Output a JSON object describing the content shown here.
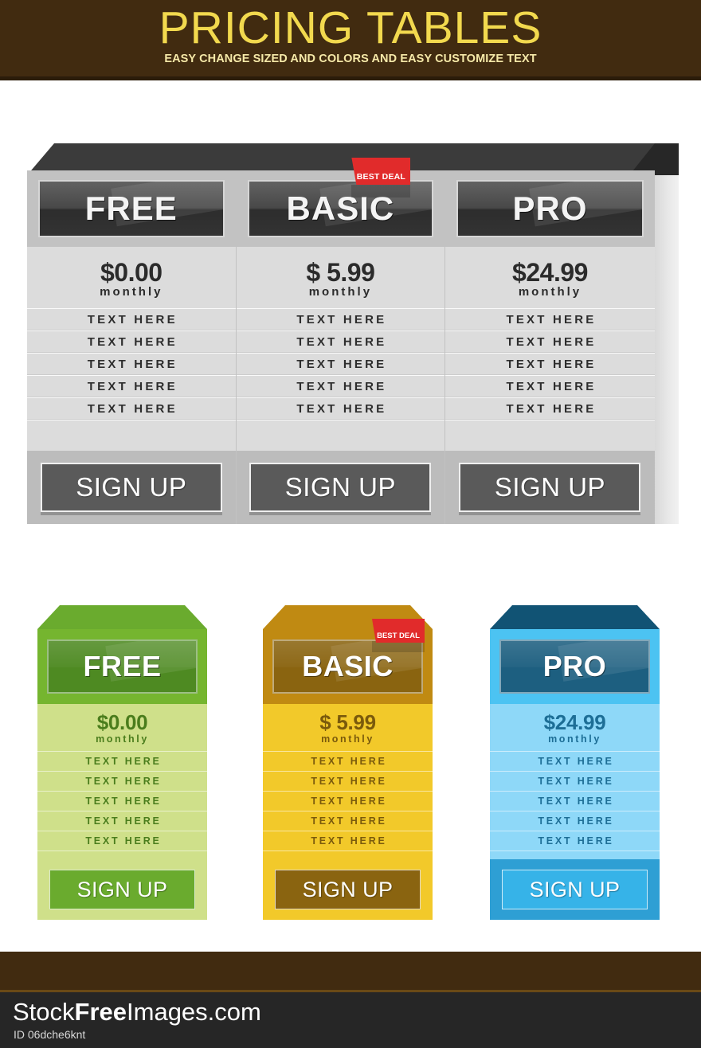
{
  "banner": {
    "title": "PRICING TABLES",
    "subtitle": "EASY CHANGE SIZED AND COLORS AND EASY CUSTOMIZE TEXT",
    "bg_color": "#412b10",
    "title_color": "#f2d94e",
    "subtitle_color": "#f6e9a8"
  },
  "gray_table": {
    "ribbon_label": "BEST DEAL",
    "ribbon_color": "#e12b2b",
    "columns": [
      {
        "plan": "FREE",
        "price": "$0.00",
        "period": "monthly",
        "features": [
          "TEXT HERE",
          "TEXT HERE",
          "TEXT HERE",
          "TEXT HERE",
          "TEXT HERE"
        ],
        "cta": "SIGN UP",
        "best_deal": false
      },
      {
        "plan": "BASIC",
        "price": "$ 5.99",
        "period": "monthly",
        "features": [
          "TEXT HERE",
          "TEXT HERE",
          "TEXT HERE",
          "TEXT HERE",
          "TEXT HERE"
        ],
        "cta": "SIGN UP",
        "best_deal": true
      },
      {
        "plan": "PRO",
        "price": "$24.99",
        "period": "monthly",
        "features": [
          "TEXT HERE",
          "TEXT HERE",
          "TEXT HERE",
          "TEXT HERE",
          "TEXT HERE"
        ],
        "cta": "SIGN UP",
        "best_deal": false
      }
    ]
  },
  "color_cards": {
    "ribbon_label": "BEST DEAL",
    "ribbon_color": "#e12b2b",
    "cards": [
      {
        "plan": "FREE",
        "price": "$0.00",
        "period": "monthly",
        "features": [
          "TEXT HERE",
          "TEXT HERE",
          "TEXT HERE",
          "TEXT HERE",
          "TEXT HERE"
        ],
        "cta": "SIGN UP",
        "best_deal": false,
        "colors": {
          "roof": "#6aab2e",
          "roof_shade": "#5d9a26",
          "body": "#cfe08a",
          "header": "#75b52f",
          "header_inner": "#4e8a22",
          "footer": "#cfe08a",
          "button": "#6aab2e",
          "text": "#4a7d1c"
        }
      },
      {
        "plan": "BASIC",
        "price": "$ 5.99",
        "period": "monthly",
        "features": [
          "TEXT HERE",
          "TEXT HERE",
          "TEXT HERE",
          "TEXT HERE",
          "TEXT HERE"
        ],
        "cta": "SIGN UP",
        "best_deal": true,
        "colors": {
          "roof": "#c08a12",
          "roof_shade": "#a9790d",
          "body": "#f2c92a",
          "header": "#c08a12",
          "header_inner": "#8a6410",
          "footer": "#f2c92a",
          "button": "#8a6410",
          "text": "#7a5a0c"
        }
      },
      {
        "plan": "PRO",
        "price": "$24.99",
        "period": "monthly",
        "features": [
          "TEXT HERE",
          "TEXT HERE",
          "TEXT HERE",
          "TEXT HERE",
          "TEXT HERE"
        ],
        "cta": "SIGN UP",
        "best_deal": false,
        "colors": {
          "roof": "#115374",
          "roof_shade": "#0d455f",
          "body": "#8ed8f8",
          "header": "#4cc3f2",
          "header_inner": "#1d5f80",
          "footer": "#2e9fd4",
          "button": "#36b3e8",
          "text": "#1d6e96"
        }
      }
    ]
  },
  "footer": {
    "brand_pre": "Stock",
    "brand_mid": "Free",
    "brand_post": "Images.com",
    "image_id": "ID 06dche6knt",
    "band_color": "#412b10",
    "bar_color": "#262626"
  }
}
